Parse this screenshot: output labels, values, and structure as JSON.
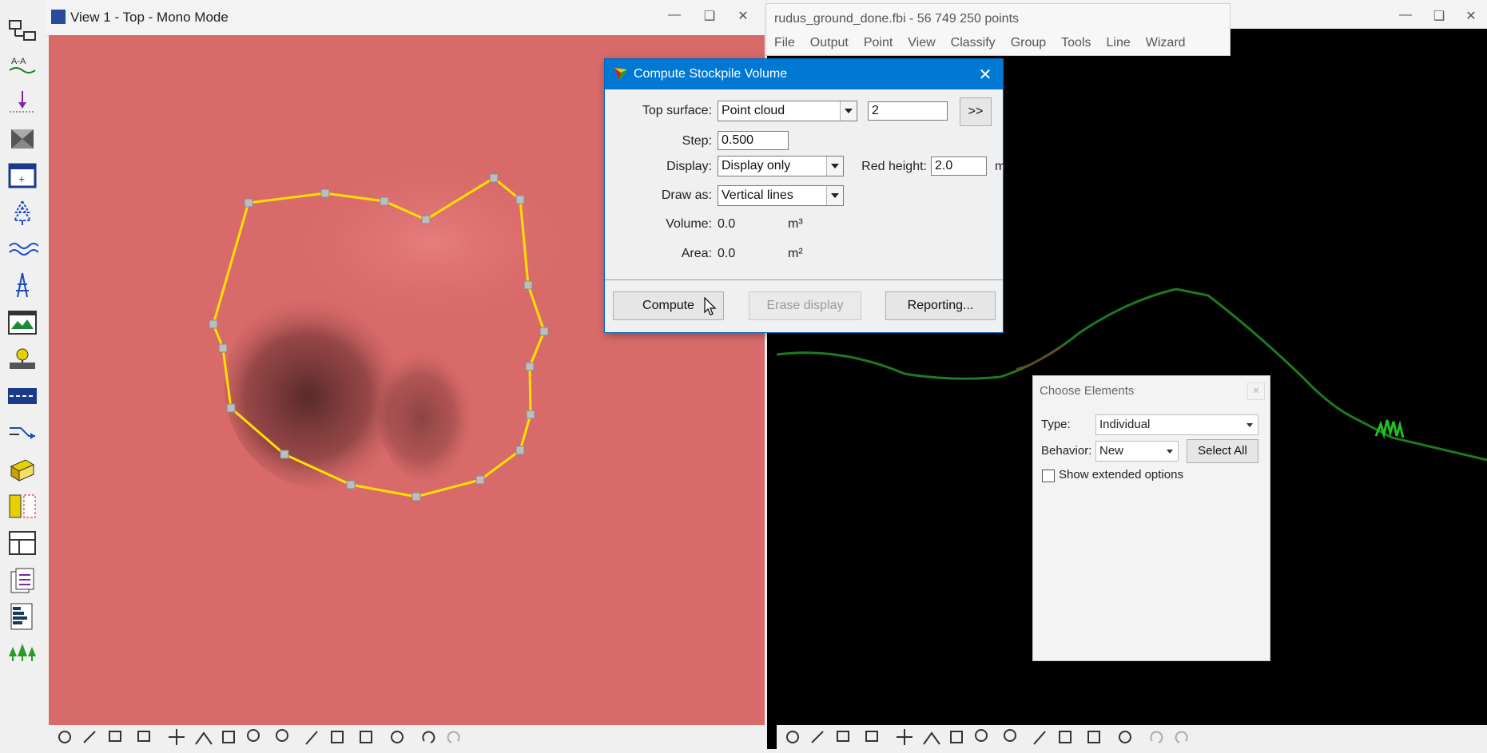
{
  "view1": {
    "title": "View 1 - Top - Mono Mode",
    "canvas_color": "#d96a6a",
    "boundary_color": "#ffe000"
  },
  "right_window": {
    "canvas_color": "#000000",
    "profile_color": "#1e7a1e"
  },
  "app": {
    "title": "rudus_ground_done.fbi - 56 749 250 points",
    "menu": [
      "File",
      "Output",
      "Point",
      "View",
      "Classify",
      "Group",
      "Tools",
      "Line",
      "Wizard"
    ]
  },
  "dialog": {
    "title": "Compute Stockpile Volume",
    "top_surface_label": "Top surface:",
    "top_surface_value": "Point cloud",
    "class_value": "2",
    "more_label": ">>",
    "step_label": "Step:",
    "step_value": "0.500",
    "display_label": "Display:",
    "display_value": "Display only",
    "red_height_label": "Red height:",
    "red_height_value": "2.0",
    "red_height_unit": "m",
    "draw_as_label": "Draw as:",
    "draw_as_value": "Vertical lines",
    "volume_label": "Volume:",
    "volume_value": "0.0",
    "volume_unit": "m³",
    "area_label": "Area:",
    "area_value": "0.0",
    "area_unit": "m²",
    "compute_label": "Compute",
    "erase_label": "Erase display",
    "reporting_label": "Reporting..."
  },
  "choose_elements": {
    "title": "Choose Elements",
    "type_label": "Type:",
    "type_value": "Individual",
    "behavior_label": "Behavior:",
    "behavior_value": "New",
    "select_all_label": "Select All",
    "extended_label": "Show extended options"
  },
  "icons": {
    "left_toolbar": [
      "network-icon",
      "section-icon",
      "point-drop-icon",
      "envelope-icon",
      "add-frame-icon",
      "tree-icon",
      "wave-icon",
      "tower-icon",
      "image-view-icon",
      "light-bulb-icon",
      "road-icon",
      "line-arrow-icon",
      "building-icon",
      "split-view-icon",
      "layout-icon",
      "document-icon",
      "histogram-icon",
      "forest-icon"
    ],
    "bottom_toolbar": [
      "gear-icon",
      "brush-icon",
      "copy-icon",
      "copy2-icon",
      "move-icon",
      "mountain-icon",
      "crop-icon",
      "zoom-in-icon",
      "zoom-out-icon",
      "fit-icon",
      "frame-icon",
      "fit-all-icon",
      "settings-icon",
      "undo-icon",
      "redo-icon"
    ]
  }
}
